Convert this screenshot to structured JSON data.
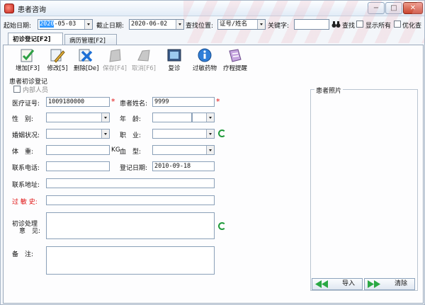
{
  "window": {
    "title": "患者咨询",
    "min": "−",
    "max": "□",
    "close": "✕"
  },
  "search": {
    "start_date_label": "起始日期:",
    "start_date_year": "2020",
    "start_date_rest": "-05-03",
    "end_date_label": "截止日期:",
    "end_date": "2020-06-02",
    "position_label": "查找位置:",
    "position_value": "证号/姓名",
    "keyword_label": "关键字:",
    "keyword_value": "",
    "find_label": "查找",
    "show_all_label": "显示所有",
    "optimize_label": "优化查"
  },
  "tabs": [
    {
      "label": "初诊登记[F2]"
    },
    {
      "label": "病历管理[F2]"
    }
  ],
  "toolbar": {
    "add": "增加[F3]",
    "edit": "修改[5]",
    "delete": "删除[De]",
    "save": "保存[F4]",
    "cancel": "取消[F6]",
    "revisit": "复诊",
    "allergy": "过敏药物",
    "course": "疗程提醒"
  },
  "form": {
    "section_title": "患者初诊登记",
    "internal_label": "内部人员",
    "card_label": "医疗证号:",
    "card_value": "1009180000",
    "name_label": "患者姓名:",
    "name_value": "9999",
    "gender_label": "性　别:",
    "gender_value": "",
    "age_label": "年　龄:",
    "age_value": "",
    "marital_label": "婚姻状况:",
    "marital_value": "",
    "job_label": "职　业:",
    "job_value": "",
    "weight_label": "体　重:",
    "weight_value": "",
    "weight_unit": "KG",
    "blood_label": "血　型:",
    "blood_value": "",
    "phone_label": "联系电话:",
    "phone_value": "",
    "reg_date_label": "登记日期:",
    "reg_date_value": "2010-09-18",
    "address_label": "联系地址:",
    "address_value": "",
    "allergy_label": "过 敏 史:",
    "allergy_value": "",
    "opinion_label_1": "初诊处理",
    "opinion_label_2": "意　见:",
    "remark_label": "备　注:",
    "required_mark": "*"
  },
  "photo": {
    "title": "患者照片",
    "import_label": "导入",
    "clear_label": "清除"
  },
  "colors": {
    "accent": "#3399ff",
    "required": "#e01010",
    "refresh": "#1f9a3a"
  }
}
